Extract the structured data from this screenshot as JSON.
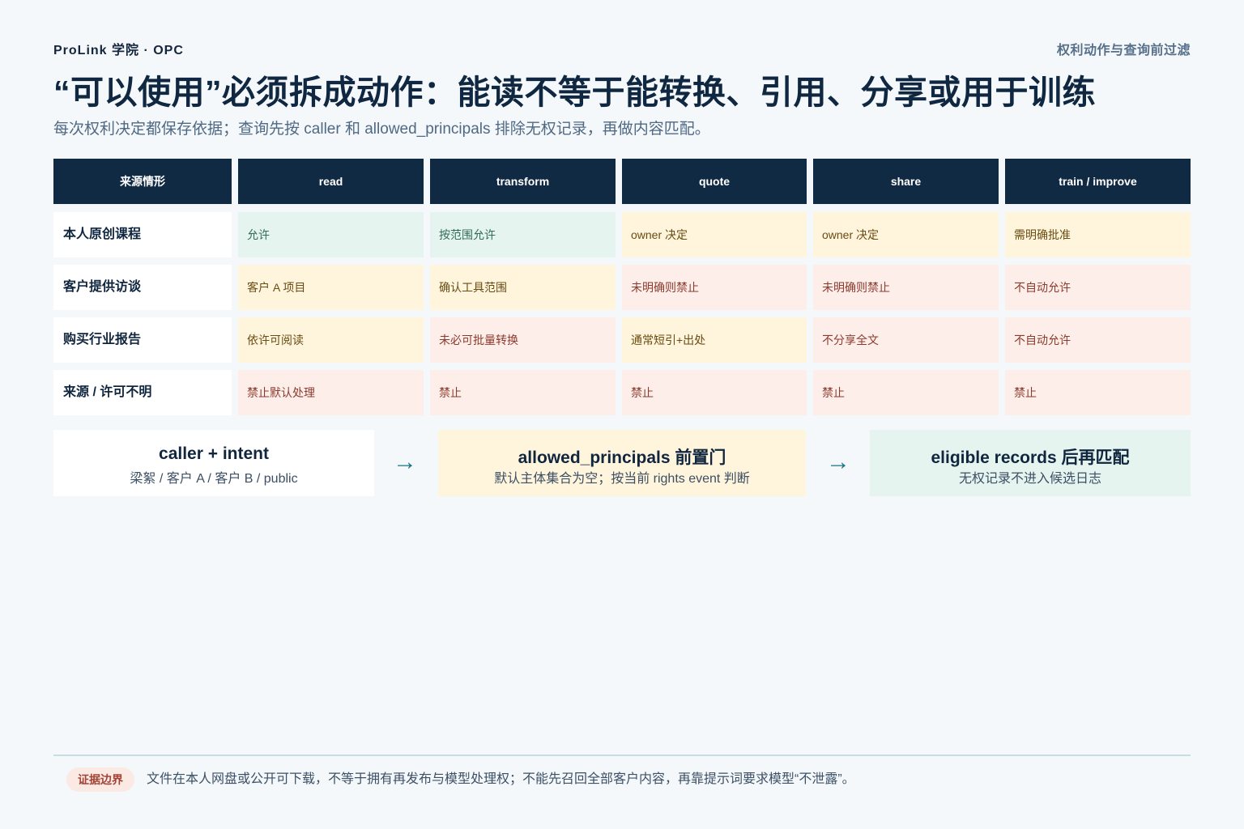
{
  "header": {
    "brand": "ProLink 学院 · OPC",
    "section": "权利动作与查询前过滤"
  },
  "title": "“可以使用”必须拆成动作：能读不等于能转换、引用、分享或用于训练",
  "subtitle": "每次权利决定都保存依据；查询先按 caller 和 allowed_principals 排除无权记录，再做内容匹配。",
  "matrix": {
    "columns": [
      "来源情形",
      "read",
      "transform",
      "quote",
      "share",
      "train / improve"
    ],
    "rows": [
      {
        "label": "本人原创课程",
        "cells": [
          {
            "text": "允许",
            "status": "allow"
          },
          {
            "text": "按范围允许",
            "status": "allow"
          },
          {
            "text": "owner 决定",
            "status": "cond"
          },
          {
            "text": "owner 决定",
            "status": "cond"
          },
          {
            "text": "需明确批准",
            "status": "cond"
          }
        ]
      },
      {
        "label": "客户提供访谈",
        "cells": [
          {
            "text": "客户 A 项目",
            "status": "cond"
          },
          {
            "text": "确认工具范围",
            "status": "cond"
          },
          {
            "text": "未明确则禁止",
            "status": "deny"
          },
          {
            "text": "未明确则禁止",
            "status": "deny"
          },
          {
            "text": "不自动允许",
            "status": "deny"
          }
        ]
      },
      {
        "label": "购买行业报告",
        "cells": [
          {
            "text": "依许可阅读",
            "status": "cond"
          },
          {
            "text": "未必可批量转换",
            "status": "deny"
          },
          {
            "text": "通常短引+出处",
            "status": "cond"
          },
          {
            "text": "不分享全文",
            "status": "deny"
          },
          {
            "text": "不自动允许",
            "status": "deny"
          }
        ]
      },
      {
        "label": "来源 / 许可不明",
        "cells": [
          {
            "text": "禁止默认处理",
            "status": "deny"
          },
          {
            "text": "禁止",
            "status": "deny"
          },
          {
            "text": "禁止",
            "status": "deny"
          },
          {
            "text": "禁止",
            "status": "deny"
          },
          {
            "text": "禁止",
            "status": "deny"
          }
        ]
      }
    ]
  },
  "flow": {
    "steps": [
      {
        "title": "caller + intent",
        "sub": "梁絮 / 客户 A / 客户 B / public"
      },
      {
        "title": "allowed_principals 前置门",
        "sub": "默认主体集合为空；按当前 rights event 判断"
      },
      {
        "title": "eligible records 后再匹配",
        "sub": "无权记录不进入候选日志"
      }
    ],
    "arrow": "→"
  },
  "footer": {
    "badge": "证据边界",
    "note": "文件在本人网盘或公开可下载，不等于拥有再发布与模型处理权；不能先召回全部客户内容，再靠提示词要求模型“不泄露”。"
  },
  "colors": {
    "header_bg": "#102a44",
    "allow_bg": "#e6f4ef",
    "cond_bg": "#fff4dc",
    "deny_bg": "#fdeeea",
    "arrow": "#1a7485"
  }
}
